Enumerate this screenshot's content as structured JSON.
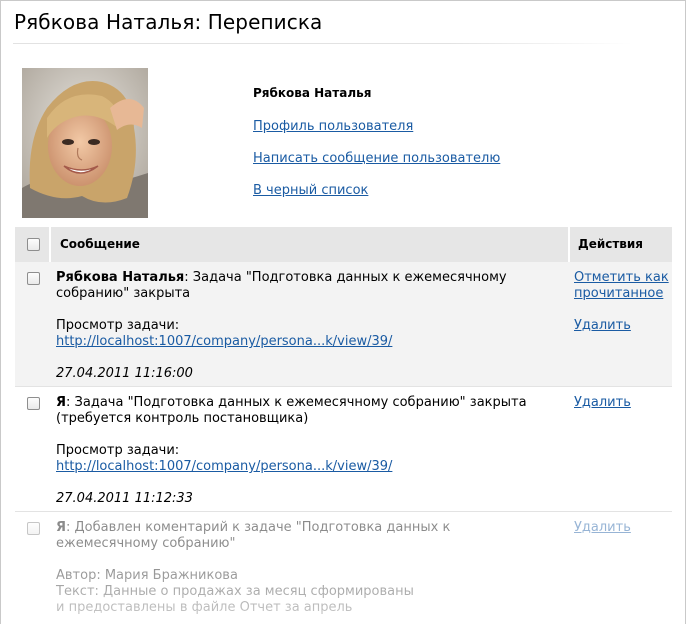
{
  "page": {
    "title": "Рябкова Наталья: Переписка"
  },
  "user": {
    "name": "Рябкова Наталья",
    "links": {
      "profile": "Профиль пользователя",
      "write": "Написать сообщение пользователю",
      "blacklist": "В черный список"
    }
  },
  "table": {
    "headers": {
      "message": "Сообщение",
      "actions": "Действия"
    },
    "rows": [
      {
        "author": "Рябкова Наталья",
        "text": ": Задача \"Подготовка данных к ежемесячному собранию\" закрыта",
        "view_label": "Просмотр задачи:",
        "link": "http://localhost:1007/company/persona...k/view/39/",
        "date": "27.04.2011 11:16:00",
        "actions": [
          "Отметить как прочитанное",
          "Удалить"
        ]
      },
      {
        "author": "Я",
        "text": ": Задача \"Подготовка данных к ежемесячному собранию\" закрыта (требуется контроль постановщика)",
        "view_label": "Просмотр задачи:",
        "link": "http://localhost:1007/company/persona...k/view/39/",
        "date": "27.04.2011 11:12:33",
        "actions": [
          "Удалить"
        ]
      },
      {
        "author": "Я",
        "text": ": Добавлен коментарий к задаче \"Подготовка данных к ежемесячному собранию\"",
        "author_line": "Автор: Мария Бражникова",
        "text_line": "Текст: Данные о продажах за месяц сформированы",
        "text_line2": "и предоставлены в файле Отчет за апрель",
        "actions": [
          "Удалить"
        ]
      }
    ]
  }
}
